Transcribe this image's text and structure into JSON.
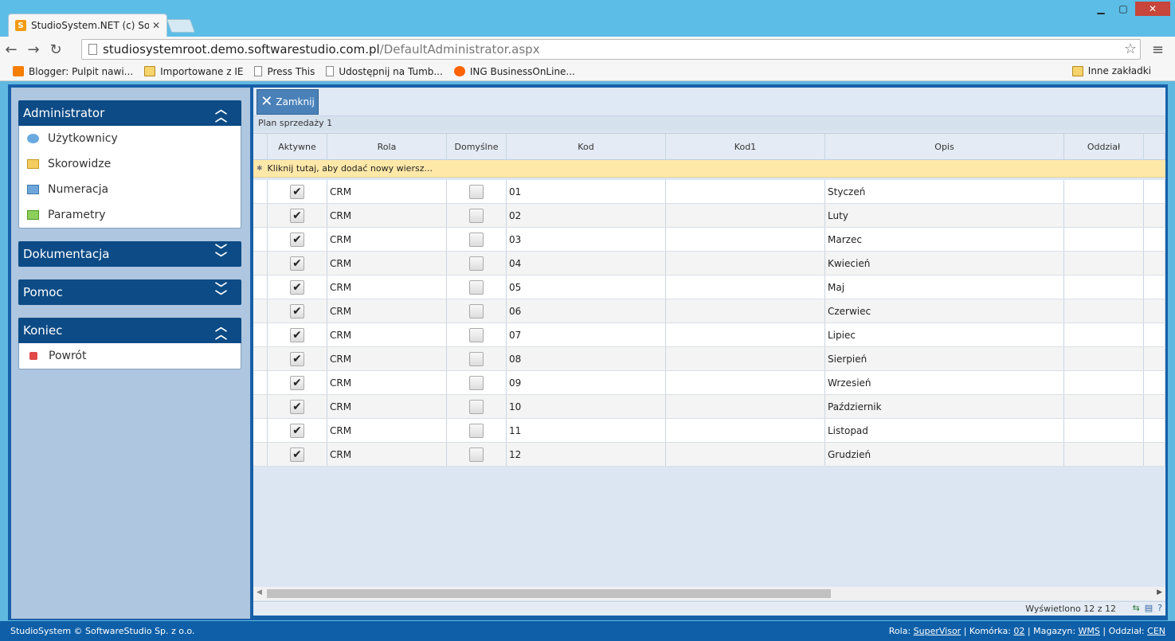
{
  "browser": {
    "tab_title": "StudioSystem.NET (c) Soft",
    "url_host": "studiosystemroot.demo.softwarestudio.com.pl",
    "url_path": "/DefaultAdministrator.aspx",
    "bookmarks": [
      {
        "label": "Blogger: Pulpit nawi...",
        "icon": "blogger-icon"
      },
      {
        "label": "Importowane z IE",
        "icon": "folder-icon"
      },
      {
        "label": "Press This",
        "icon": "page-icon"
      },
      {
        "label": "Udostępnij na Tumb...",
        "icon": "page-icon"
      },
      {
        "label": "ING BusinessOnLine...",
        "icon": "ing-icon"
      }
    ],
    "other_bookmarks": "Inne zakładki"
  },
  "sidebar": {
    "panels": [
      {
        "title": "Administrator",
        "expanded": true,
        "items": [
          "Użytkownicy",
          "Skorowidze",
          "Numeracja",
          "Parametry"
        ]
      },
      {
        "title": "Dokumentacja",
        "expanded": false,
        "items": []
      },
      {
        "title": "Pomoc",
        "expanded": false,
        "items": []
      },
      {
        "title": "Koniec",
        "expanded": true,
        "items": [
          "Powrót"
        ]
      }
    ]
  },
  "content": {
    "close_button": "Zamknij",
    "caption": "Plan sprzedaży 1",
    "columns": [
      "Aktywne",
      "Rola",
      "Domyślne",
      "Kod",
      "Kod1",
      "Opis",
      "Oddział"
    ],
    "add_row_text": "Kliknij tutaj, aby dodać nowy wiersz...",
    "rows": [
      {
        "aktywne": true,
        "rola": "CRM",
        "domyslne": false,
        "kod": "01",
        "kod1": "",
        "opis": "Styczeń",
        "oddzial": ""
      },
      {
        "aktywne": true,
        "rola": "CRM",
        "domyslne": false,
        "kod": "02",
        "kod1": "",
        "opis": "Luty",
        "oddzial": ""
      },
      {
        "aktywne": true,
        "rola": "CRM",
        "domyslne": false,
        "kod": "03",
        "kod1": "",
        "opis": "Marzec",
        "oddzial": ""
      },
      {
        "aktywne": true,
        "rola": "CRM",
        "domyslne": false,
        "kod": "04",
        "kod1": "",
        "opis": "Kwiecień",
        "oddzial": ""
      },
      {
        "aktywne": true,
        "rola": "CRM",
        "domyslne": false,
        "kod": "05",
        "kod1": "",
        "opis": "Maj",
        "oddzial": ""
      },
      {
        "aktywne": true,
        "rola": "CRM",
        "domyslne": false,
        "kod": "06",
        "kod1": "",
        "opis": "Czerwiec",
        "oddzial": ""
      },
      {
        "aktywne": true,
        "rola": "CRM",
        "domyslne": false,
        "kod": "07",
        "kod1": "",
        "opis": "Lipiec",
        "oddzial": ""
      },
      {
        "aktywne": true,
        "rola": "CRM",
        "domyslne": false,
        "kod": "08",
        "kod1": "",
        "opis": "Sierpień",
        "oddzial": ""
      },
      {
        "aktywne": true,
        "rola": "CRM",
        "domyslne": false,
        "kod": "09",
        "kod1": "",
        "opis": "Wrzesień",
        "oddzial": ""
      },
      {
        "aktywne": true,
        "rola": "CRM",
        "domyslne": false,
        "kod": "10",
        "kod1": "",
        "opis": "Październik",
        "oddzial": ""
      },
      {
        "aktywne": true,
        "rola": "CRM",
        "domyslne": false,
        "kod": "11",
        "kod1": "",
        "opis": "Listopad",
        "oddzial": ""
      },
      {
        "aktywne": true,
        "rola": "CRM",
        "domyslne": false,
        "kod": "12",
        "kod1": "",
        "opis": "Grudzień",
        "oddzial": ""
      }
    ],
    "pager_info": "Wyświetlono 12 z 12"
  },
  "status": {
    "copyright": "StudioSystem © SoftwareStudio Sp. z o.o.",
    "rola_label": "Rola:",
    "rola_value": "SuperVisor",
    "komorka_label": "Komórka:",
    "komorka_value": "02",
    "magazyn_label": "Magazyn:",
    "magazyn_value": "WMS",
    "oddzial_label": "Oddział:",
    "oddzial_value": "CEN"
  }
}
